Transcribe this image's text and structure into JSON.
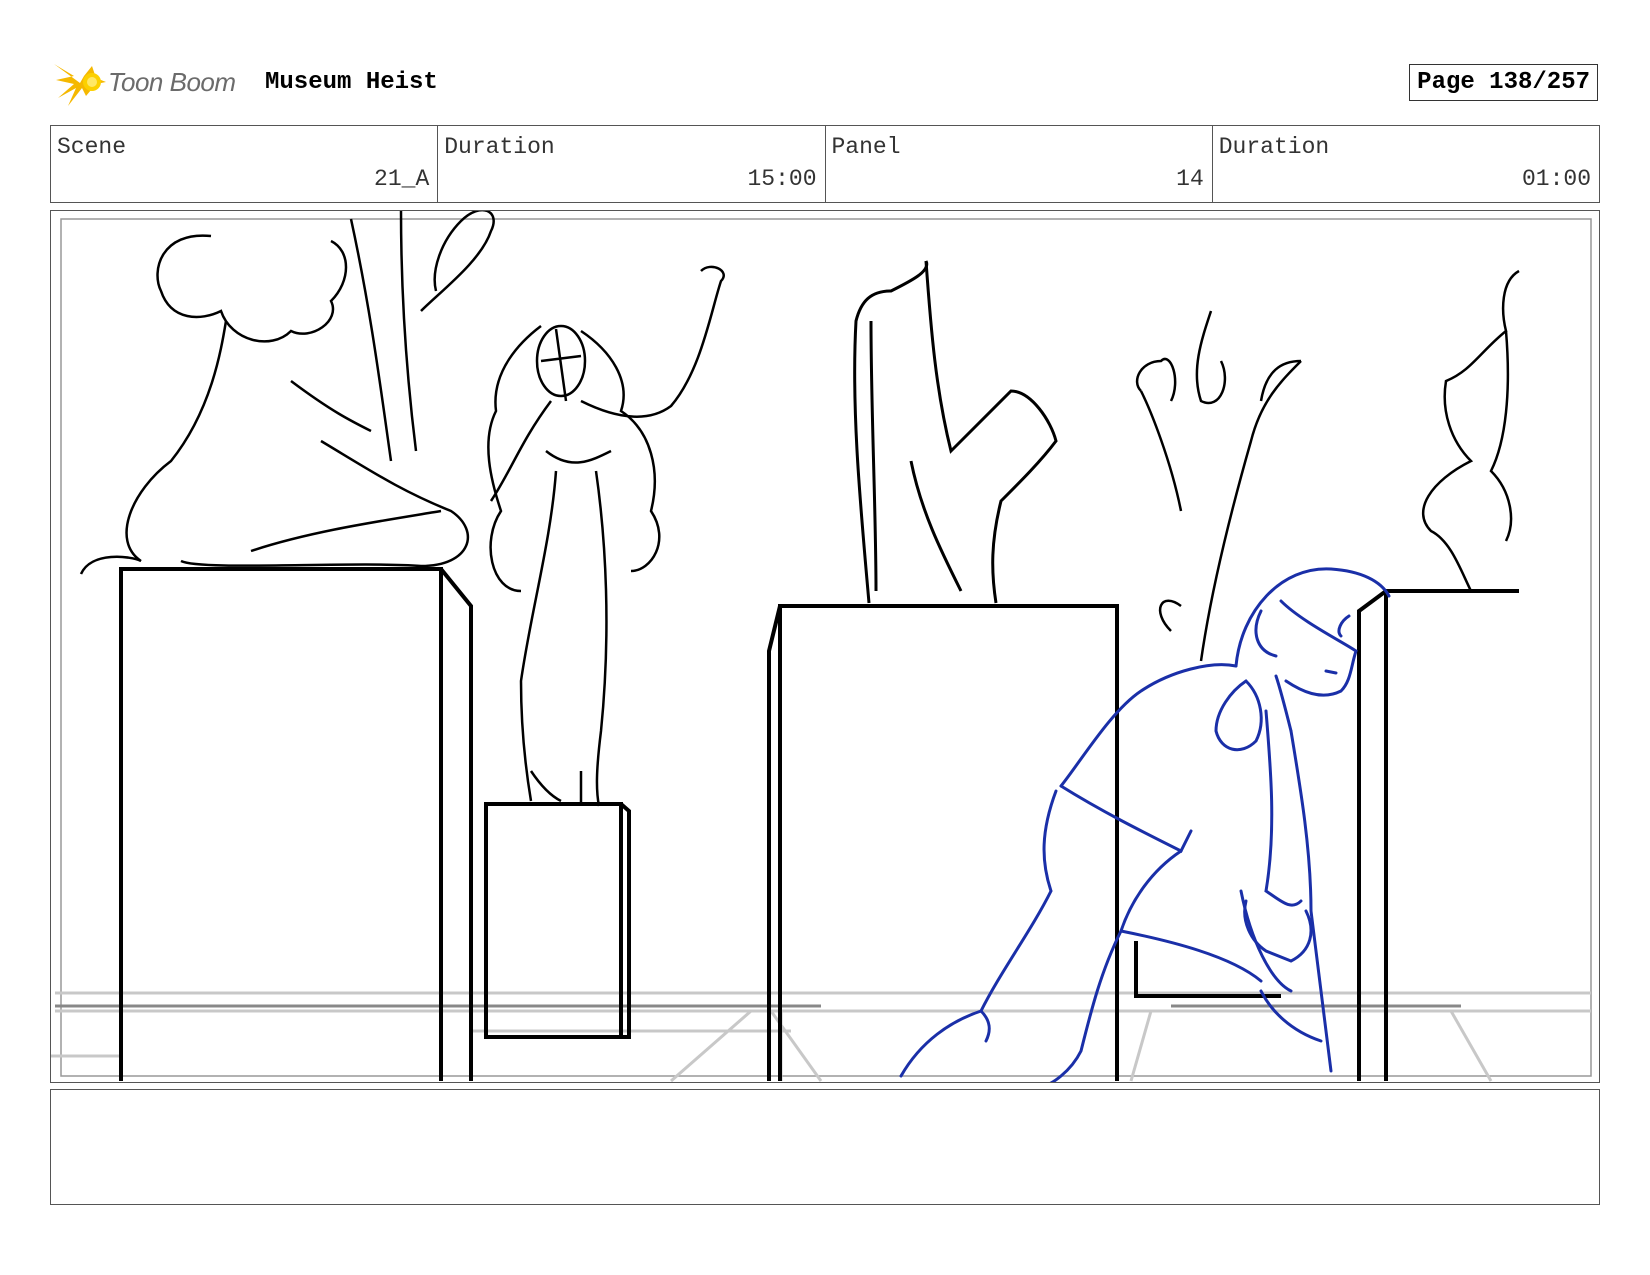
{
  "header": {
    "logo_text": "Toon Boom",
    "project_title": "Museum Heist",
    "page_label": "Page 138/257"
  },
  "info": {
    "scene": {
      "label": "Scene",
      "value": "21_A"
    },
    "scene_duration": {
      "label": "Duration",
      "value": "15:00"
    },
    "panel": {
      "label": "Panel",
      "value": "14"
    },
    "panel_duration": {
      "label": "Duration",
      "value": "01:00"
    }
  },
  "colors": {
    "sketch": "#000000",
    "character": "#1a2fa8",
    "logo_accent": "#f5b800",
    "border": "#555555"
  },
  "icons": {
    "logo": "starburst-logo-icon"
  }
}
